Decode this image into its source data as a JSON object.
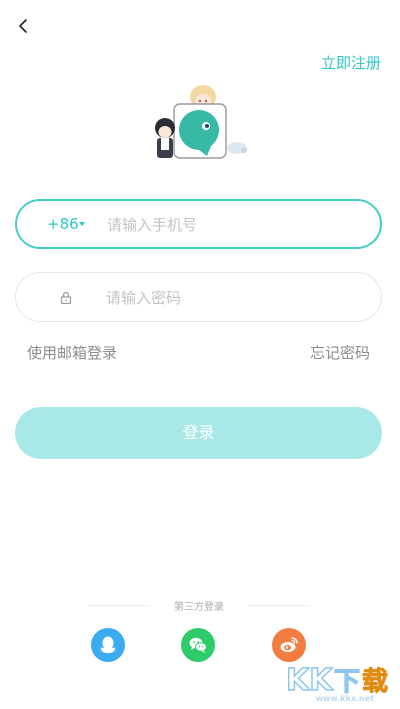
{
  "header": {
    "back_icon": "chevron-left-icon",
    "register_label": "立即注册"
  },
  "logo": {
    "icon": "app-mascot-logo"
  },
  "phone": {
    "country_code": "+86",
    "placeholder": "请输入手机号",
    "value": ""
  },
  "password": {
    "icon": "lock-icon",
    "placeholder": "请输入密码",
    "value": ""
  },
  "links": {
    "email_login": "使用邮箱登录",
    "forgot_password": "忘记密码"
  },
  "login_button": "登录",
  "third_party": {
    "title": "第三方登录",
    "providers": [
      {
        "name": "qq",
        "icon": "qq-penguin-icon",
        "color": "#3aabf0"
      },
      {
        "name": "wechat",
        "icon": "wechat-chat-icon",
        "color": "#2ecb6b"
      },
      {
        "name": "weibo",
        "icon": "weibo-eye-icon",
        "color": "#f37c40"
      }
    ]
  },
  "watermark": {
    "brand": "KK下载",
    "url": "www.kkx.net"
  },
  "colors": {
    "accent": "#2ec8c2",
    "button": "#a8e9e8"
  }
}
